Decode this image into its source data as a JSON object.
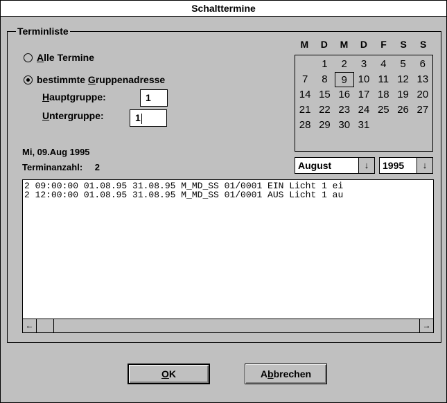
{
  "window": {
    "title": "Schalttermine"
  },
  "group": {
    "legend": "Terminliste"
  },
  "radios": {
    "all": {
      "underline": "A",
      "rest": "lle Termine",
      "checked": false
    },
    "specific": {
      "pre": "bestimmte ",
      "underline": "G",
      "rest": "ruppenadresse",
      "checked": true
    }
  },
  "fields": {
    "haupt": {
      "underline": "H",
      "rest": "auptgruppe:",
      "value": "1"
    },
    "unter": {
      "underline": "U",
      "rest": "ntergruppe:",
      "value": "1"
    }
  },
  "info": {
    "date": "Mi, 09.Aug 1995",
    "count_label": "Terminanzahl:",
    "count_value": "2"
  },
  "calendar": {
    "weekdays": [
      "M",
      "D",
      "M",
      "D",
      "F",
      "S",
      "S"
    ],
    "leading_blanks": 1,
    "days": [
      "1",
      "2",
      "3",
      "4",
      "5",
      "6",
      "7",
      "8",
      "9",
      "10",
      "11",
      "12",
      "13",
      "14",
      "15",
      "16",
      "17",
      "18",
      "19",
      "20",
      "21",
      "22",
      "23",
      "24",
      "25",
      "26",
      "27",
      "28",
      "29",
      "30",
      "31"
    ],
    "selected_day": "9",
    "month": "August",
    "year": "1995"
  },
  "list": {
    "rows": [
      "2 09:00:00 01.08.95 31.08.95 M_MD_SS 01/0001 EIN Licht 1 ei",
      "2 12:00:00 01.08.95 31.08.95 M_MD_SS 01/0001 AUS Licht 1 au"
    ]
  },
  "buttons": {
    "ok": {
      "underline": "O",
      "rest": "K"
    },
    "cancel": {
      "pre": "A",
      "underline": "b",
      "rest": "brechen"
    }
  },
  "icons": {
    "dropdown": "↓",
    "scroll_left": "←",
    "scroll_right": "→"
  }
}
